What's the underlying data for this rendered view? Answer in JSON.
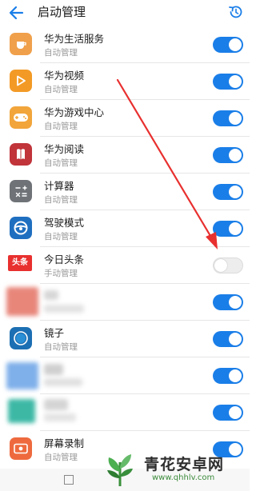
{
  "header": {
    "title": "启动管理",
    "back_icon": "arrow-left-icon",
    "history_icon": "clock-history-icon",
    "accent": "#1a7ee8"
  },
  "apps": [
    {
      "name": "华为生活服务",
      "mode": "自动管理",
      "enabled": true,
      "icon": "cup-icon",
      "icon_color": "#f0a04b"
    },
    {
      "name": "华为视频",
      "mode": "自动管理",
      "enabled": true,
      "icon": "play-icon",
      "icon_color": "#f39a26"
    },
    {
      "name": "华为游戏中心",
      "mode": "自动管理",
      "enabled": true,
      "icon": "gamepad-icon",
      "icon_color": "#f2a53b"
    },
    {
      "name": "华为阅读",
      "mode": "自动管理",
      "enabled": true,
      "icon": "book-icon",
      "icon_color": "#c0343a"
    },
    {
      "name": "计算器",
      "mode": "自动管理",
      "enabled": true,
      "icon": "calculator-icon",
      "icon_color": "#6f7378"
    },
    {
      "name": "驾驶模式",
      "mode": "自动管理",
      "enabled": true,
      "icon": "steering-wheel-icon",
      "icon_color": "#1f6fc0"
    },
    {
      "name": "今日头条",
      "mode": "手动管理",
      "enabled": false,
      "icon": "toutiao-icon",
      "icon_color": "#e8302f",
      "icon_text": "头条"
    },
    {
      "name": "",
      "mode": "",
      "enabled": true,
      "icon": "blurred-app-icon",
      "icon_color": "#e8867a"
    },
    {
      "name": "镜子",
      "mode": "自动管理",
      "enabled": true,
      "icon": "mirror-icon",
      "icon_color": "#1c6fb3"
    },
    {
      "name": "",
      "mode": "",
      "enabled": true,
      "icon": "blurred-app-icon",
      "icon_color": "#7fb0ea"
    },
    {
      "name": "",
      "mode": "",
      "enabled": true,
      "icon": "blurred-app-icon",
      "icon_color": "#3db8a5"
    },
    {
      "name": "屏幕录制",
      "mode": "自动管理",
      "enabled": true,
      "icon": "screen-record-icon",
      "icon_color": "#ee6a3e"
    }
  ],
  "watermark": {
    "title": "青花安卓网",
    "url": "www.qhhlv.com"
  },
  "annotation": {
    "arrow_color": "#e8302f"
  }
}
